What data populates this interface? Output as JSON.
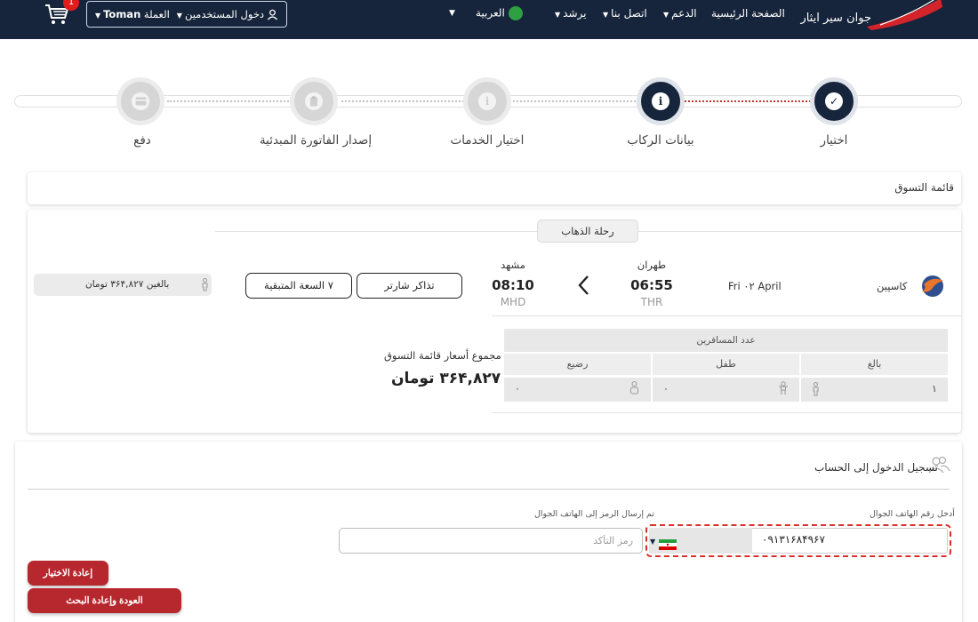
{
  "header": {
    "nav": [
      "الصفحة الرئيسية",
      "الدعم",
      "اتصل بنا",
      "يرشد"
    ],
    "language": "العربية",
    "login_label": "دخول المستخدمين",
    "currency_label": "العملة",
    "currency_value": "Toman",
    "cart_count": "1",
    "logo_text": "جوان سیر ایثار"
  },
  "steps": [
    {
      "label": "اختيار",
      "state": "done",
      "icon": "check-icon"
    },
    {
      "label": "بيانات الركاب",
      "state": "current",
      "icon": "info-icon"
    },
    {
      "label": "اختيار الخدمات",
      "state": "pending",
      "icon": "info-icon"
    },
    {
      "label": "إصدار الفاتورة المبدئية",
      "state": "pending",
      "icon": "clipboard-icon"
    },
    {
      "label": "دفع",
      "state": "pending",
      "icon": "card-icon"
    }
  ],
  "basket": {
    "title": "قائمة التسوق",
    "trip_tab": "رحلة الذهاب",
    "airline": "كاسپين",
    "date": "Fri ۰۲ April",
    "origin": {
      "city": "طهران",
      "time": "06:55",
      "code": "THR"
    },
    "destination": {
      "city": "مشهد",
      "time": "08:10",
      "code": "MHD"
    },
    "ticket_type": "تذاكر شارتر",
    "seats_left": "۷ السعة المتبقية",
    "adult_price": "بالغين ۳۶۴,۸۲۷ تومان",
    "passengers_header": "عدد المسافرين",
    "passenger_types": [
      {
        "label": "بالغ",
        "count": "۱"
      },
      {
        "label": "طفل",
        "count": "۰"
      },
      {
        "label": "رضيع",
        "count": "۰"
      }
    ],
    "total_label": "مجموع أسعار قائمة التسوق",
    "total_value": "۳۶۴,۸۲۷ تومان"
  },
  "login": {
    "title": "تسجيل الدخول إلى الحساب",
    "phone_label": "أدخل رقم الهاتف الجوال",
    "phone_value": "۰۹۱۳۱۶۸۴۹۶۷",
    "code_label": "تم إرسال الرمز إلى الهاتف الجوال",
    "code_placeholder": "رمز التأكد",
    "reselect_button": "إعادة الاختيار",
    "back_button": "العودة وإعادة البحث"
  },
  "colors": {
    "header_bg": "#16253b",
    "accent_red": "#b7282e",
    "dashed_red": "#d9302c"
  }
}
